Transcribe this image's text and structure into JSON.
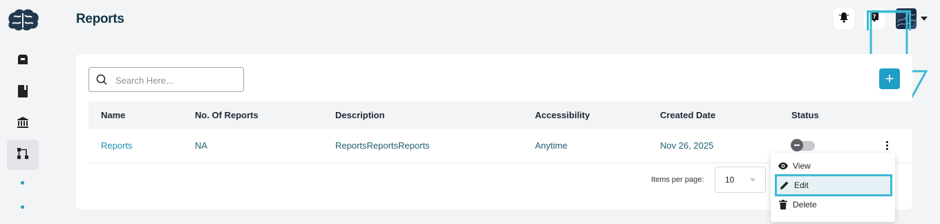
{
  "header": {
    "title": "Reports",
    "notification_icon": "bell-icon",
    "help_icon": "help-icon"
  },
  "sidebar": {
    "logo_icon": "brain-logo-icon",
    "items": [
      {
        "icon": "box-icon"
      },
      {
        "icon": "book-icon"
      },
      {
        "icon": "bank-icon"
      },
      {
        "icon": "workflow-icon",
        "active": true
      }
    ]
  },
  "search": {
    "placeholder": "Search Here..."
  },
  "add_button": {
    "label": "+"
  },
  "table": {
    "columns": [
      "Name",
      "No. Of Reports",
      "Description",
      "Accessibility",
      "Created Date",
      "Status"
    ],
    "rows": [
      {
        "name": "Reports",
        "no_of_reports": "NA",
        "description": "ReportsReportsReports",
        "accessibility": "Anytime",
        "created_date": "Nov 26, 2025",
        "status_enabled": false
      }
    ]
  },
  "pagination": {
    "items_per_page_label": "Items per page:",
    "items_per_page_value": "10"
  },
  "row_menu": {
    "items": [
      {
        "label": "View",
        "icon": "eye-icon"
      },
      {
        "label": "Edit",
        "icon": "pencil-icon"
      },
      {
        "label": "Delete",
        "icon": "trash-icon"
      }
    ]
  },
  "colors": {
    "accent": "#1f9ec6",
    "title": "#0c3446",
    "annotation": "#3cbad3"
  }
}
